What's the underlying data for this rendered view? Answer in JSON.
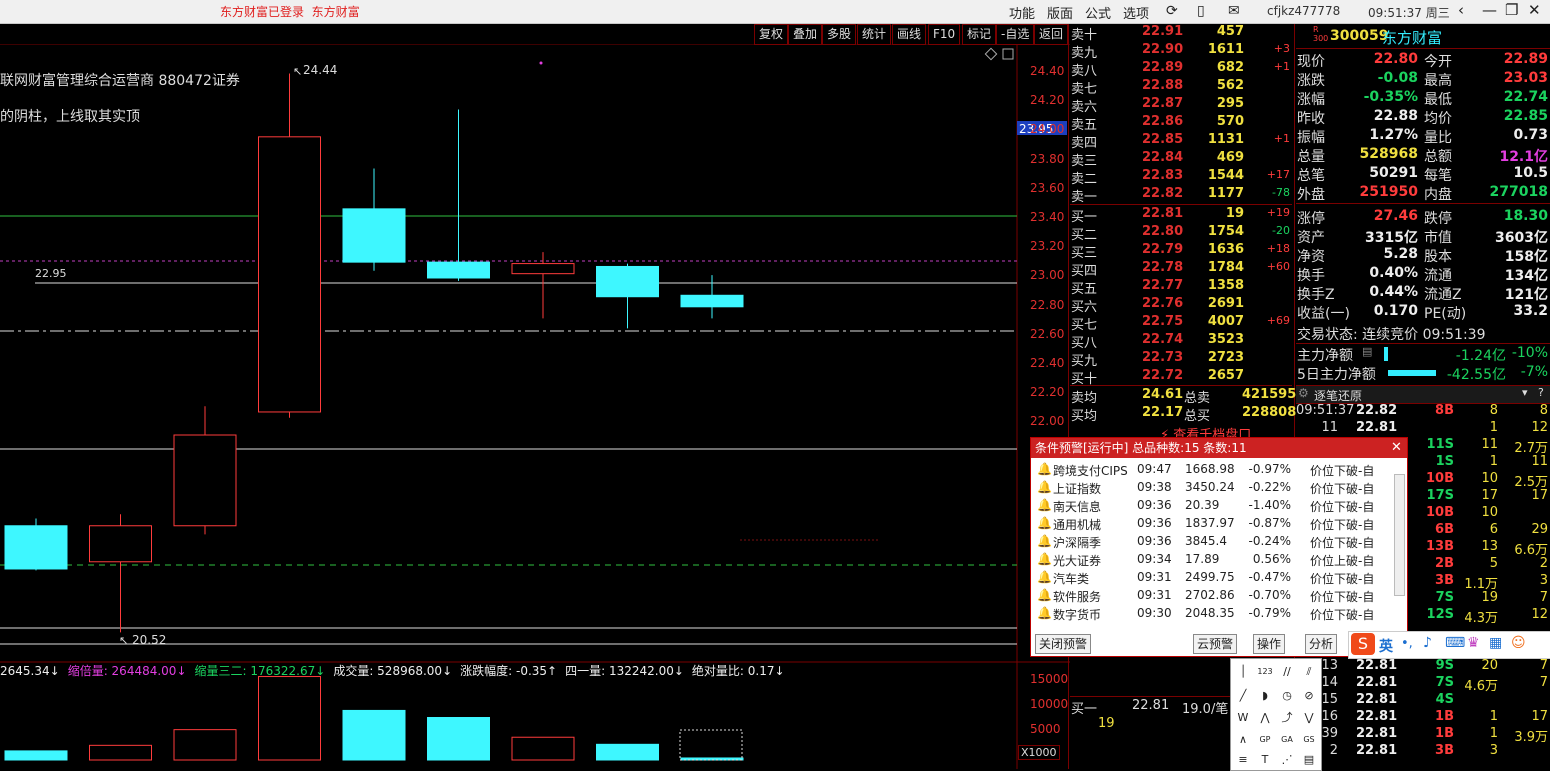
{
  "topbar": {
    "brand_login": "东方财富已登录",
    "brand_name": "东方财富",
    "menus": [
      "功能",
      "版面",
      "公式",
      "选项"
    ],
    "user": "cfjkz477778",
    "clock": "09:51:37 周三"
  },
  "toolbar": [
    "复权",
    "叠加",
    "多股",
    "统计",
    "画线",
    "F10",
    "标记",
    "-自选",
    "返回"
  ],
  "chart": {
    "caption_line1": "联网财富管理综合运营商  880472证券",
    "caption_line2": "的阴柱，上线取其实顶",
    "high_label": "24.44",
    "low_label": "20.52",
    "level_label": "22.95",
    "cursor_price": "23.95",
    "y_ticks": [
      "24.40",
      "24.20",
      "24.00",
      "23.80",
      "23.60",
      "23.40",
      "23.20",
      "23.00",
      "22.80",
      "22.60",
      "22.40",
      "22.20",
      "22.00"
    ],
    "vol_ticks": [
      "15000",
      "10000",
      "5000"
    ],
    "vol_unit": "X1000",
    "indicator_text": [
      {
        "t": "2645.34↓",
        "c": "white"
      },
      {
        "t": "缩倍量: 264484.00↓",
        "c": "mag"
      },
      {
        "t": "缩量三二: 176322.67↓",
        "c": "green"
      },
      {
        "t": "成交量: 528968.00↓",
        "c": "white"
      },
      {
        "t": "涨跌幅度: -0.35↑",
        "c": "white"
      },
      {
        "t": "四一量: 132242.00↓",
        "c": "white"
      },
      {
        "t": "绝对量比: 0.17↓",
        "c": "white"
      }
    ]
  },
  "chart_data": {
    "type": "candlestick",
    "ylim": [
      21.9,
      24.5
    ],
    "candles": [
      {
        "o": 21.3,
        "c": 21.0,
        "h": 21.35,
        "l": 20.99,
        "dir": "down"
      },
      {
        "o": 21.05,
        "c": 21.3,
        "h": 21.38,
        "l": 20.56,
        "dir": "up"
      },
      {
        "o": 21.3,
        "c": 21.93,
        "h": 22.13,
        "l": 21.24,
        "dir": "up"
      },
      {
        "o": 22.09,
        "c": 24.0,
        "h": 24.44,
        "l": 22.05,
        "dir": "up"
      },
      {
        "o": 23.5,
        "c": 23.13,
        "h": 23.78,
        "l": 23.07,
        "dir": "down"
      },
      {
        "o": 23.13,
        "c": 23.02,
        "h": 24.19,
        "l": 23.0,
        "dir": "down"
      },
      {
        "o": 23.05,
        "c": 23.12,
        "h": 23.2,
        "l": 22.74,
        "dir": "up"
      },
      {
        "o": 23.1,
        "c": 22.89,
        "h": 23.12,
        "l": 22.67,
        "dir": "down"
      },
      {
        "o": 22.9,
        "c": 22.82,
        "h": 23.04,
        "l": 22.74,
        "dir": "down"
      }
    ],
    "volumes": [
      1800,
      2900,
      6000,
      16500,
      9800,
      8400,
      4500,
      3100,
      400
    ],
    "vol_max": 17000
  },
  "orderbook": {
    "asks": [
      {
        "label": "卖十",
        "price": "22.91",
        "vol": "457",
        "chg": ""
      },
      {
        "label": "卖九",
        "price": "22.90",
        "vol": "1611",
        "chg": "+3"
      },
      {
        "label": "卖八",
        "price": "22.89",
        "vol": "682",
        "chg": "+1"
      },
      {
        "label": "卖七",
        "price": "22.88",
        "vol": "562",
        "chg": ""
      },
      {
        "label": "卖六",
        "price": "22.87",
        "vol": "295",
        "chg": ""
      },
      {
        "label": "卖五",
        "price": "22.86",
        "vol": "570",
        "chg": ""
      },
      {
        "label": "卖四",
        "price": "22.85",
        "vol": "1131",
        "chg": "+1"
      },
      {
        "label": "卖三",
        "price": "22.84",
        "vol": "469",
        "chg": ""
      },
      {
        "label": "卖二",
        "price": "22.83",
        "vol": "1544",
        "chg": "+17"
      },
      {
        "label": "卖一",
        "price": "22.82",
        "vol": "1177",
        "chg": "-78"
      }
    ],
    "bids": [
      {
        "label": "买一",
        "price": "22.81",
        "vol": "19",
        "chg": "+19"
      },
      {
        "label": "买二",
        "price": "22.80",
        "vol": "1754",
        "chg": "-20"
      },
      {
        "label": "买三",
        "price": "22.79",
        "vol": "1636",
        "chg": "+18"
      },
      {
        "label": "买四",
        "price": "22.78",
        "vol": "1784",
        "chg": "+60"
      },
      {
        "label": "买五",
        "price": "22.77",
        "vol": "1358",
        "chg": ""
      },
      {
        "label": "买六",
        "price": "22.76",
        "vol": "2691",
        "chg": ""
      },
      {
        "label": "买七",
        "price": "22.75",
        "vol": "4007",
        "chg": "+69"
      },
      {
        "label": "买八",
        "price": "22.74",
        "vol": "3523",
        "chg": ""
      },
      {
        "label": "买九",
        "price": "22.73",
        "vol": "2723",
        "chg": ""
      },
      {
        "label": "买十",
        "price": "22.72",
        "vol": "2657",
        "chg": ""
      }
    ],
    "avg_sell_label": "卖均",
    "avg_sell": "24.61",
    "total_sell_label": "总卖",
    "total_sell": "421595",
    "avg_buy_label": "买均",
    "avg_buy": "22.17",
    "total_buy_label": "总买",
    "total_buy": "228808",
    "more_link": "查看千档盘口",
    "buy1_label": "买一",
    "buy1_price": "22.81",
    "buy1_extra": "19.0/笔",
    "buy1_vol": "19"
  },
  "quote": {
    "code": "300059",
    "name": "东方财富",
    "tag_r": "R",
    "tag_300": "300",
    "rows": [
      {
        "l": "现价",
        "v": "22.80",
        "vc": "red",
        "l2": "今开",
        "v2": "22.89",
        "v2c": "red"
      },
      {
        "l": "涨跌",
        "v": "-0.08",
        "vc": "green",
        "l2": "最高",
        "v2": "23.03",
        "v2c": "red"
      },
      {
        "l": "涨幅",
        "v": "-0.35%",
        "vc": "green",
        "l2": "最低",
        "v2": "22.74",
        "v2c": "green"
      },
      {
        "l": "昨收",
        "v": "22.88",
        "vc": "white",
        "l2": "均价",
        "v2": "22.85",
        "v2c": "green"
      },
      {
        "l": "振幅",
        "v": "1.27%",
        "vc": "white",
        "l2": "量比",
        "v2": "0.73",
        "v2c": "white"
      },
      {
        "l": "总量",
        "v": "528968",
        "vc": "yellow",
        "l2": "总额",
        "v2": "12.1亿",
        "v2c": "mag"
      },
      {
        "l": "总笔",
        "v": "50291",
        "vc": "white",
        "l2": "每笔",
        "v2": "10.5",
        "v2c": "white"
      },
      {
        "l": "外盘",
        "v": "251950",
        "vc": "red",
        "l2": "内盘",
        "v2": "277018",
        "v2c": "green"
      },
      {
        "l": "涨停",
        "v": "27.46",
        "vc": "red",
        "l2": "跌停",
        "v2": "18.30",
        "v2c": "green"
      },
      {
        "l": "资产",
        "v": "3315亿",
        "vc": "white",
        "l2": "市值",
        "v2": "3603亿",
        "v2c": "white"
      },
      {
        "l": "净资",
        "v": "5.28",
        "vc": "white",
        "l2": "股本",
        "v2": "158亿",
        "v2c": "white"
      },
      {
        "l": "换手",
        "v": "0.40%",
        "vc": "white",
        "l2": "流通",
        "v2": "134亿",
        "v2c": "white"
      },
      {
        "l": "换手Z",
        "v": "0.44%",
        "vc": "white",
        "l2": "流通Z",
        "v2": "121亿",
        "v2c": "white"
      },
      {
        "l": "收益(一)",
        "v": "0.170",
        "vc": "white",
        "l2": "PE(动)",
        "v2": "33.2",
        "v2c": "white"
      }
    ],
    "trade_status": "交易状态: 连续竞价 09:51:39",
    "flow1_label": "主力净额",
    "flow1_val": "-1.24亿",
    "flow1_pct": "-10%",
    "flow2_label": "5日主力净额",
    "flow2_val": "-42.55亿",
    "flow2_pct": "-7%",
    "tick_title": "逐笔还原",
    "ticks": [
      {
        "time": "09:51:37",
        "price": "22.82",
        "bs": "8B",
        "n": "8",
        "m": "8"
      },
      {
        "time": "11",
        "price": "22.81",
        "bs": "",
        "n": "1",
        "m": "12"
      },
      {
        "time": "",
        "price": "",
        "bs": "11S",
        "n": "11",
        "m": "2.7万"
      },
      {
        "time": "",
        "price": "",
        "bs": "1S",
        "n": "1",
        "m": "11"
      },
      {
        "time": "",
        "price": "",
        "bs": "10B",
        "n": "10",
        "m": "2.5万"
      },
      {
        "time": "",
        "price": "",
        "bs": "17S",
        "n": "17",
        "m": "17"
      },
      {
        "time": "",
        "price": "",
        "bs": "10B",
        "n": "10",
        "m": ""
      },
      {
        "time": "",
        "price": "",
        "bs": "6B",
        "n": "6",
        "m": "29"
      },
      {
        "time": "",
        "price": "",
        "bs": "13B",
        "n": "13",
        "m": "6.6万"
      },
      {
        "time": "",
        "price": "",
        "bs": "2B",
        "n": "5",
        "m": "2"
      },
      {
        "time": "",
        "price": "",
        "bs": "3B",
        "n": "1.1万",
        "m": "3"
      },
      {
        "time": "",
        "price": "",
        "bs": "7S",
        "n": "19",
        "m": "7"
      },
      {
        "time": "",
        "price": "",
        "bs": "12S",
        "n": "4.3万",
        "m": "12"
      }
    ],
    "ticks_bottom": [
      {
        "time": "13",
        "price": "22.81",
        "bs": "9S",
        "n": "20",
        "m": "7"
      },
      {
        "time": "14",
        "price": "22.81",
        "bs": "7S",
        "n": "4.6万",
        "m": "7"
      },
      {
        "time": "15",
        "price": "22.81",
        "bs": "4S",
        "n": "",
        "m": ""
      },
      {
        "time": "16",
        "price": "22.81",
        "bs": "1B",
        "n": "1",
        "m": "17"
      },
      {
        "time": "51:39",
        "price": "22.81",
        "bs": "1B",
        "n": "1",
        "m": "3.9万"
      },
      {
        "time": "2",
        "price": "22.81",
        "bs": "3B",
        "n": "3",
        "m": ""
      }
    ]
  },
  "alert": {
    "header": "条件预警[运行中] 总品种数:15 条数:11",
    "rows": [
      {
        "name": "跨境支付CIPS",
        "time": "09:47",
        "price": "1668.98",
        "pct": "-0.97%",
        "desc": "价位下破-自"
      },
      {
        "name": "上证指数",
        "time": "09:38",
        "price": "3450.24",
        "pct": "-0.22%",
        "desc": "价位下破-自"
      },
      {
        "name": "南天信息",
        "time": "09:36",
        "price": "20.39",
        "pct": "-1.40%",
        "desc": "价位下破-自"
      },
      {
        "name": "通用机械",
        "time": "09:36",
        "price": "1837.97",
        "pct": "-0.87%",
        "desc": "价位下破-自"
      },
      {
        "name": "沪深隔季",
        "time": "09:36",
        "price": "3845.4",
        "pct": "-0.24%",
        "desc": "价位下破-自"
      },
      {
        "name": "光大证券",
        "time": "09:34",
        "price": "17.89",
        "pct": "0.56%",
        "desc": "价位上破-自"
      },
      {
        "name": "汽车类",
        "time": "09:31",
        "price": "2499.75",
        "pct": "-0.47%",
        "desc": "价位下破-自"
      },
      {
        "name": "软件服务",
        "time": "09:31",
        "price": "2702.86",
        "pct": "-0.70%",
        "desc": "价位下破-自"
      },
      {
        "name": "数字货币",
        "time": "09:30",
        "price": "2048.35",
        "pct": "-0.79%",
        "desc": "价位下破-自"
      }
    ],
    "btn_close": "关闭预警",
    "btn_cloud": "云预警",
    "btn_op": "操作",
    "btn_analysis": "分析",
    "ime_label": "英"
  },
  "colors": {
    "up": "#ff3c3c",
    "down": "#3ef7ff",
    "grid": "#7a0000",
    "accent_blue": "#1c3fbf"
  }
}
